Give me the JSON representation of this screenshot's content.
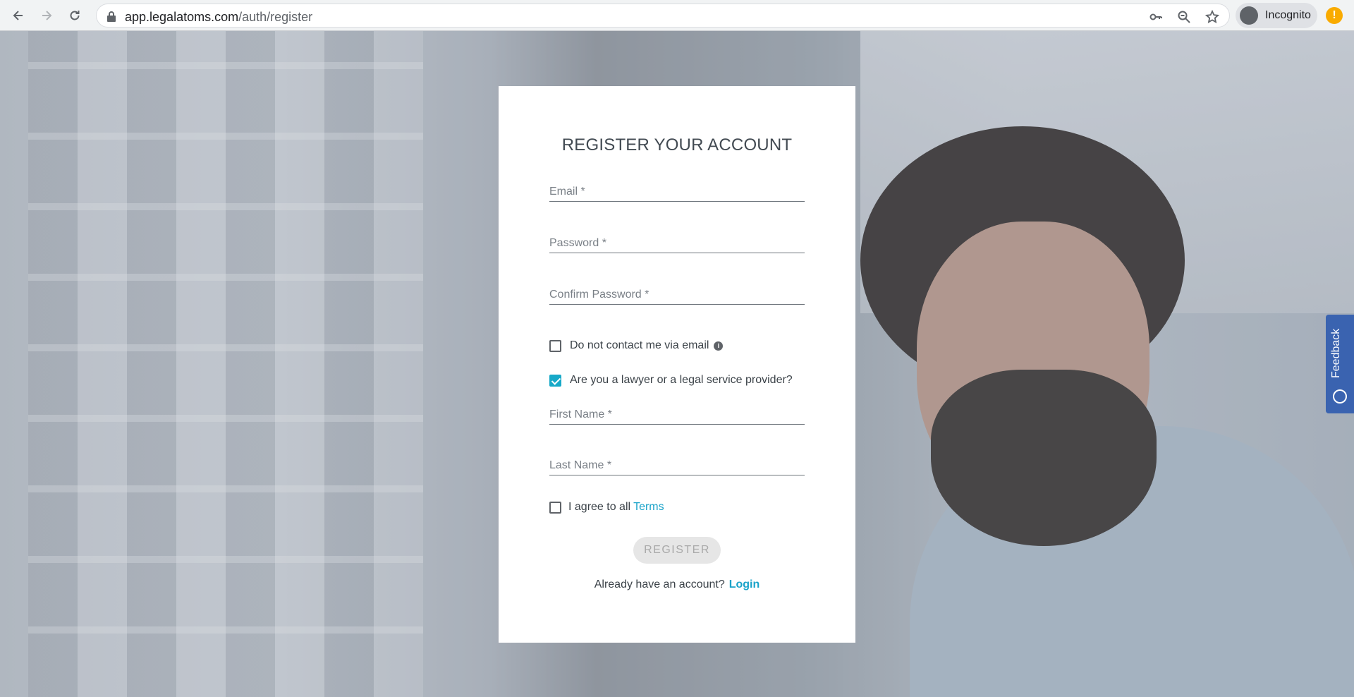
{
  "browser": {
    "url_domain": "app.legalatoms.com",
    "url_path": "/auth/register",
    "profile_label": "Incognito",
    "alert_badge": "!"
  },
  "form": {
    "title": "REGISTER YOUR ACCOUNT",
    "email_label": "Email *",
    "password_label": "Password *",
    "confirm_password_label": "Confirm Password *",
    "no_contact_label": "Do not contact me via email",
    "no_contact_checked": false,
    "lawyer_label": "Are you a lawyer or a legal service provider?",
    "lawyer_checked": true,
    "first_name_label": "First Name *",
    "last_name_label": "Last Name *",
    "agree_label": "I agree to all",
    "terms_link": "Terms",
    "agree_checked": false,
    "register_button": "REGISTER",
    "login_prompt": "Already have an account?",
    "login_link": "Login"
  },
  "feedback": {
    "label": "Feedback"
  },
  "colors": {
    "accent": "#17a9c8",
    "link": "#1aa3c9",
    "feedback_tab": "#3a63b0"
  }
}
